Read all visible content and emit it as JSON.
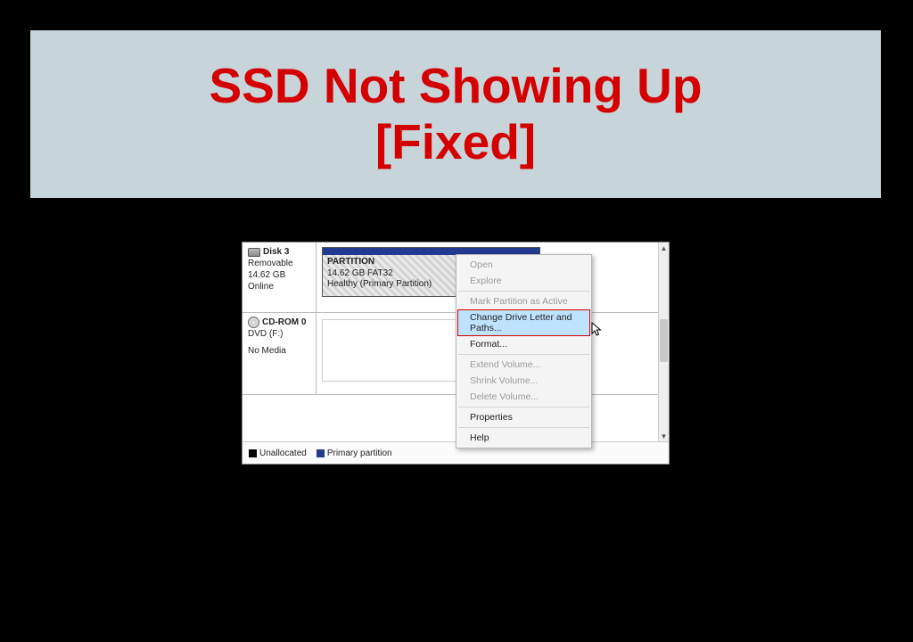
{
  "title_banner": {
    "text": "SSD Not Showing Up\n[Fixed]"
  },
  "disks": [
    {
      "name": "Disk 3",
      "type": "Removable",
      "size": "14.62 GB",
      "status": "Online",
      "icon": "disk",
      "volume": {
        "label": "PARTITION",
        "detail": "14.62 GB FAT32",
        "health": "Healthy (Primary Partition)"
      }
    },
    {
      "name": "CD-ROM 0",
      "type": "DVD (F:)",
      "size": "",
      "status": "No Media",
      "icon": "cd",
      "volume": null
    }
  ],
  "legend": {
    "unallocated": "Unallocated",
    "primary": "Primary partition"
  },
  "context_menu": {
    "items": [
      {
        "label": "Open",
        "enabled": false
      },
      {
        "label": "Explore",
        "enabled": false
      },
      {
        "sep": true
      },
      {
        "label": "Mark Partition as Active",
        "enabled": false
      },
      {
        "label": "Change Drive Letter and Paths...",
        "enabled": true,
        "highlight": true
      },
      {
        "label": "Format...",
        "enabled": true
      },
      {
        "sep": true
      },
      {
        "label": "Extend Volume...",
        "enabled": false
      },
      {
        "label": "Shrink Volume...",
        "enabled": false
      },
      {
        "label": "Delete Volume...",
        "enabled": false
      },
      {
        "sep": true
      },
      {
        "label": "Properties",
        "enabled": true
      },
      {
        "sep": true
      },
      {
        "label": "Help",
        "enabled": true
      }
    ]
  }
}
